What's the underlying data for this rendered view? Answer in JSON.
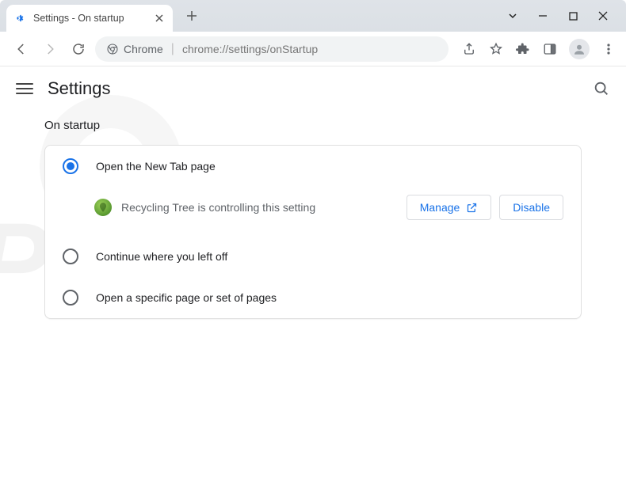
{
  "window": {
    "tab": {
      "title": "Settings - On startup"
    }
  },
  "toolbar": {
    "chrome_chip": "Chrome",
    "url": "chrome://settings/onStartup"
  },
  "appheader": {
    "title": "Settings"
  },
  "section": {
    "title": "On startup"
  },
  "options": {
    "new_tab": "Open the New Tab page",
    "continue": "Continue where you left off",
    "specific": "Open a specific page or set of pages"
  },
  "extension_notice": {
    "name": "Recycling Tree is controlling this setting",
    "manage_label": "Manage",
    "disable_label": "Disable"
  }
}
